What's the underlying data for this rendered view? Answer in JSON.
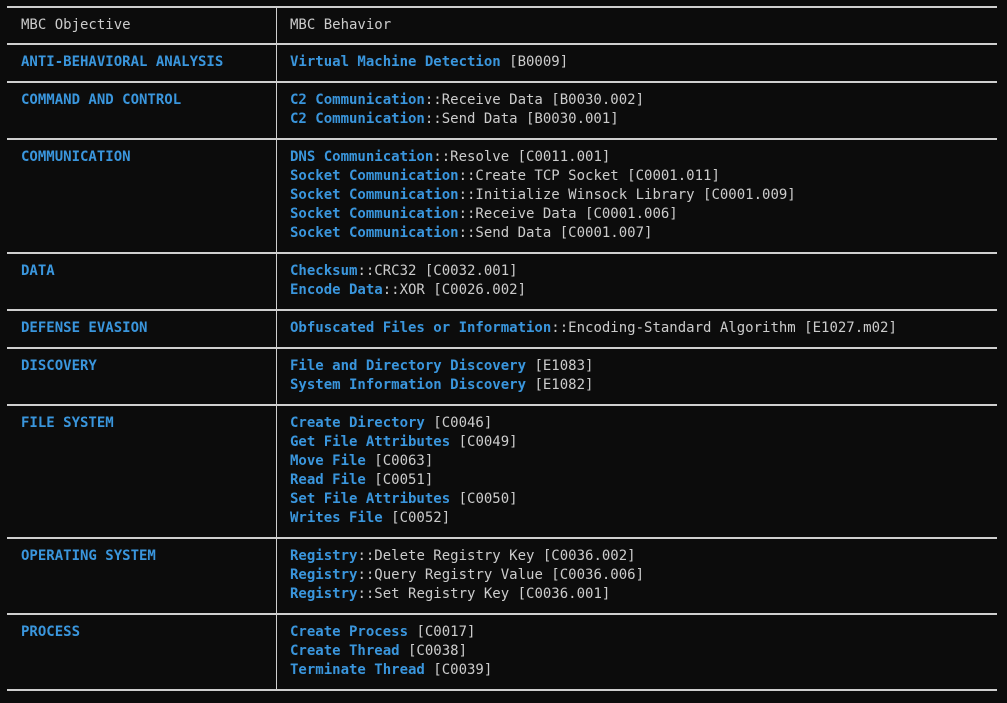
{
  "header": {
    "objective": "MBC Objective",
    "behavior": "MBC Behavior"
  },
  "colors": {
    "accent": "#3a96dd",
    "text": "#cccccc",
    "background": "#0c0c0c",
    "border": "#cfcfcf"
  },
  "rows": [
    {
      "objective": "ANTI-BEHAVIORAL ANALYSIS",
      "behaviors": [
        {
          "name": "Virtual Machine Detection",
          "rest": " [B0009]"
        }
      ]
    },
    {
      "objective": "COMMAND AND CONTROL",
      "behaviors": [
        {
          "name": "C2 Communication",
          "rest": "::Receive Data [B0030.002]"
        },
        {
          "name": "C2 Communication",
          "rest": "::Send Data [B0030.001]"
        }
      ]
    },
    {
      "objective": "COMMUNICATION",
      "behaviors": [
        {
          "name": "DNS Communication",
          "rest": "::Resolve [C0011.001]"
        },
        {
          "name": "Socket Communication",
          "rest": "::Create TCP Socket [C0001.011]"
        },
        {
          "name": "Socket Communication",
          "rest": "::Initialize Winsock Library [C0001.009]"
        },
        {
          "name": "Socket Communication",
          "rest": "::Receive Data [C0001.006]"
        },
        {
          "name": "Socket Communication",
          "rest": "::Send Data [C0001.007]"
        }
      ]
    },
    {
      "objective": "DATA",
      "behaviors": [
        {
          "name": "Checksum",
          "rest": "::CRC32 [C0032.001]"
        },
        {
          "name": "Encode Data",
          "rest": "::XOR [C0026.002]"
        }
      ]
    },
    {
      "objective": "DEFENSE EVASION",
      "behaviors": [
        {
          "name": "Obfuscated Files or Information",
          "rest": "::Encoding-Standard Algorithm [E1027.m02]"
        }
      ]
    },
    {
      "objective": "DISCOVERY",
      "behaviors": [
        {
          "name": "File and Directory Discovery",
          "rest": " [E1083]"
        },
        {
          "name": "System Information Discovery",
          "rest": " [E1082]"
        }
      ]
    },
    {
      "objective": "FILE SYSTEM",
      "behaviors": [
        {
          "name": "Create Directory",
          "rest": " [C0046]"
        },
        {
          "name": "Get File Attributes",
          "rest": " [C0049]"
        },
        {
          "name": "Move File",
          "rest": " [C0063]"
        },
        {
          "name": "Read File",
          "rest": " [C0051]"
        },
        {
          "name": "Set File Attributes",
          "rest": " [C0050]"
        },
        {
          "name": "Writes File",
          "rest": " [C0052]"
        }
      ]
    },
    {
      "objective": "OPERATING SYSTEM",
      "behaviors": [
        {
          "name": "Registry",
          "rest": "::Delete Registry Key [C0036.002]"
        },
        {
          "name": "Registry",
          "rest": "::Query Registry Value [C0036.006]"
        },
        {
          "name": "Registry",
          "rest": "::Set Registry Key [C0036.001]"
        }
      ]
    },
    {
      "objective": "PROCESS",
      "behaviors": [
        {
          "name": "Create Process",
          "rest": " [C0017]"
        },
        {
          "name": "Create Thread",
          "rest": " [C0038]"
        },
        {
          "name": "Terminate Thread",
          "rest": " [C0039]"
        }
      ]
    }
  ]
}
